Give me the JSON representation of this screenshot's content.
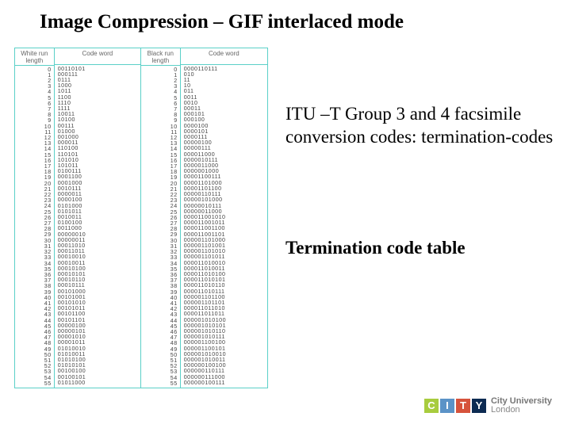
{
  "title": "Image Compression – GIF interlaced mode",
  "headers": {
    "white_run": "White\nrun\nlength",
    "white_code": "Code\nword",
    "black_run": "Black\nrun\nlength",
    "black_code": "Code\nword"
  },
  "table": {
    "runs": "0\n1\n2\n3\n4\n5\n6\n7\n8\n9\n10\n11\n12\n13\n14\n15\n16\n17\n18\n19\n20\n21\n22\n23\n24\n25\n26\n27\n28\n29\n30\n31\n32\n33\n34\n35\n36\n37\n38\n39\n40\n41\n42\n43\n44\n45\n46\n47\n48\n49\n50\n51\n52\n53\n54\n55",
    "white": "00110101\n000111\n0111\n1000\n1011\n1100\n1110\n1111\n10011\n10100\n00111\n01000\n001000\n000011\n110100\n110101\n101010\n101011\n0100111\n0001100\n0001000\n0010111\n0000011\n0000100\n0101000\n0101011\n0010011\n0100100\n0011000\n00000010\n00000011\n00011010\n00011011\n00010010\n00010011\n00010100\n00010101\n00010110\n00010111\n00101000\n00101001\n00101010\n00101011\n00101100\n00101101\n00000100\n00000101\n00001010\n00001011\n01010010\n01010011\n01010100\n01010101\n00100100\n00100101\n01011000",
    "black": "0000110111\n010\n11\n10\n011\n0011\n0010\n00011\n000101\n000100\n0000100\n0000101\n0000111\n00000100\n00000111\n000011000\n0000010111\n0000011000\n0000001000\n00001100111\n00001101000\n00001101100\n00000110111\n00000101000\n00000010111\n00000011000\n000011001010\n000011001011\n000011001100\n000011001101\n000001101000\n000001101001\n000001101010\n000001101011\n000011010010\n000011010011\n000011010100\n000011010101\n000011010110\n000011010111\n000001101100\n000001101101\n000011011010\n000011011011\n000001010100\n000001010101\n000001010110\n000001010111\n000001100100\n000001100101\n000001010010\n000001010011\n000000100100\n000000110111\n000000111000\n000000100111"
  },
  "para1": "ITU –T Group 3 and 4 facsimile conversion codes: termination-codes",
  "para2": "Termination code table",
  "logo": {
    "c": "C",
    "i": "I",
    "t": "T",
    "y": "Y",
    "line1": "City University",
    "line2": "London"
  }
}
